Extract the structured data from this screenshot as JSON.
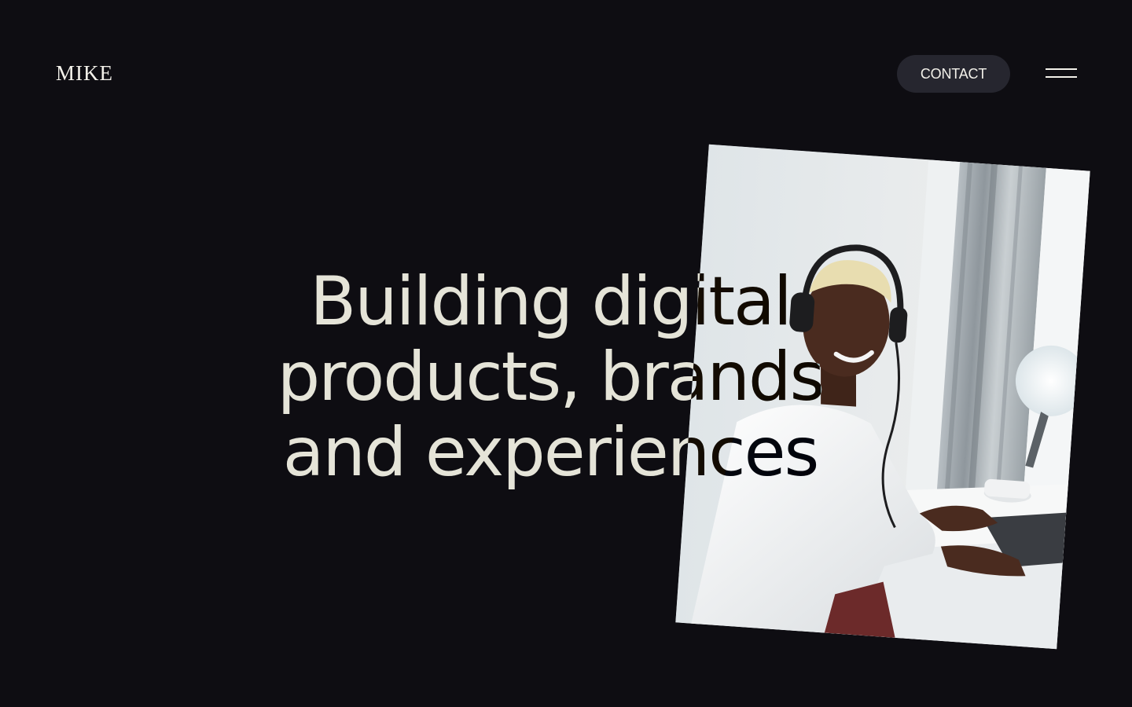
{
  "header": {
    "logo": "MIKE",
    "contact_label": "CONTACT",
    "menu_icon": "hamburger-menu-icon"
  },
  "hero": {
    "headline_lines": [
      "Building digital",
      "products, brands",
      "and experiences"
    ],
    "photo_description_icon": "hero-photo"
  },
  "colors": {
    "background": "#0e0d12",
    "text": "#f3f1ea",
    "button_bg": "#26262f"
  }
}
